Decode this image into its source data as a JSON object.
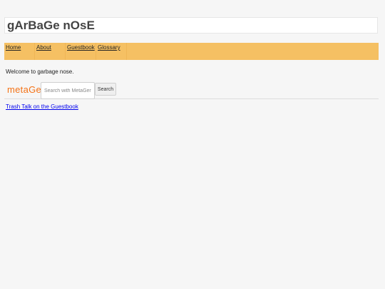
{
  "header": {
    "title": "gArBaGe nOsE"
  },
  "nav": {
    "items": [
      {
        "label": "Home"
      },
      {
        "label": "About"
      },
      {
        "label": "Guestbook"
      },
      {
        "label": "Glossary"
      }
    ]
  },
  "main": {
    "welcome_text": "Welcome to garbage nose.",
    "guestbook_link": "Trash Talk on the Guestbook"
  },
  "search": {
    "logo_text": "metaGer",
    "placeholder": "Search with MetaGer...",
    "value": "",
    "button_label": "Search"
  },
  "colors": {
    "nav_background": "#f5c063",
    "logo": "#f47216",
    "link": "#0000ee"
  }
}
